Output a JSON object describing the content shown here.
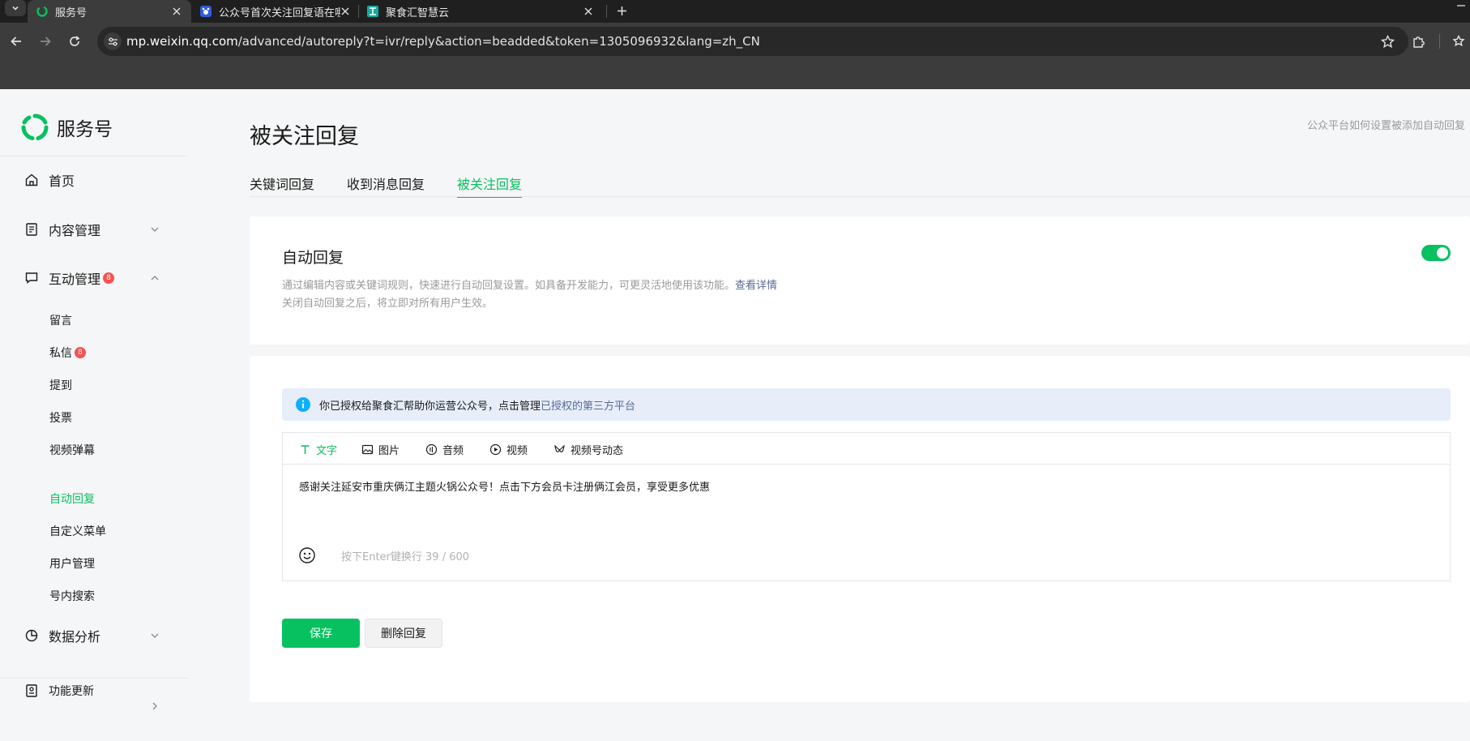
{
  "browser": {
    "tabs": [
      {
        "title": "服务号",
        "active": true
      },
      {
        "title": "公众号首次关注回复语在哪里设",
        "active": false
      },
      {
        "title": "聚食汇智慧云",
        "active": false
      }
    ],
    "url_host": "mp.weixin.qq.com",
    "url_path": "/advanced/autoreply?t=ivr/reply&action=beadded&token=1305096932&lang=zh_CN"
  },
  "sidebar": {
    "brand": "服务号",
    "home": "首页",
    "content": "内容管理",
    "interaction": "互动管理",
    "interaction_badge": "8",
    "sub": {
      "comments": "留言",
      "messages": "私信",
      "messages_badge": "8",
      "mentions": "提到",
      "vote": "投票",
      "danmu": "视频弹幕",
      "autoreply": "自动回复",
      "custom_menu": "自定义菜单",
      "users": "用户管理",
      "search": "号内搜索"
    },
    "analytics": "数据分析",
    "updates": "功能更新"
  },
  "main": {
    "title": "被关注回复",
    "help_link": "公众平台如何设置被添加自动回复",
    "tabs": [
      "关键词回复",
      "收到消息回复",
      "被关注回复"
    ],
    "auto_card": {
      "title": "自动回复",
      "desc1": "通过编辑内容或关键词规则，快速进行自动回复设置。如具备开发能力，可更灵活地使用该功能。",
      "desc1_link": "查看详情",
      "desc2": "关闭自动回复之后，将立即对所有用户生效。",
      "enabled": true
    },
    "notice": {
      "text": "你已授权给聚食汇帮助你运营公众号，点击管理",
      "link": "已授权的第三方平台"
    },
    "editor": {
      "tabs": [
        "文字",
        "图片",
        "音频",
        "视频",
        "视频号动态"
      ],
      "content": "感谢关注延安市重庆俩江主题火锅公众号！点击下方会员卡注册俩江会员，享受更多优惠",
      "hint": "按下Enter键换行 39 / 600"
    },
    "save": "保存",
    "delete": "删除回复"
  },
  "colors": {
    "accent": "#07c160",
    "link": "#576b95",
    "badge": "#fa5151"
  }
}
